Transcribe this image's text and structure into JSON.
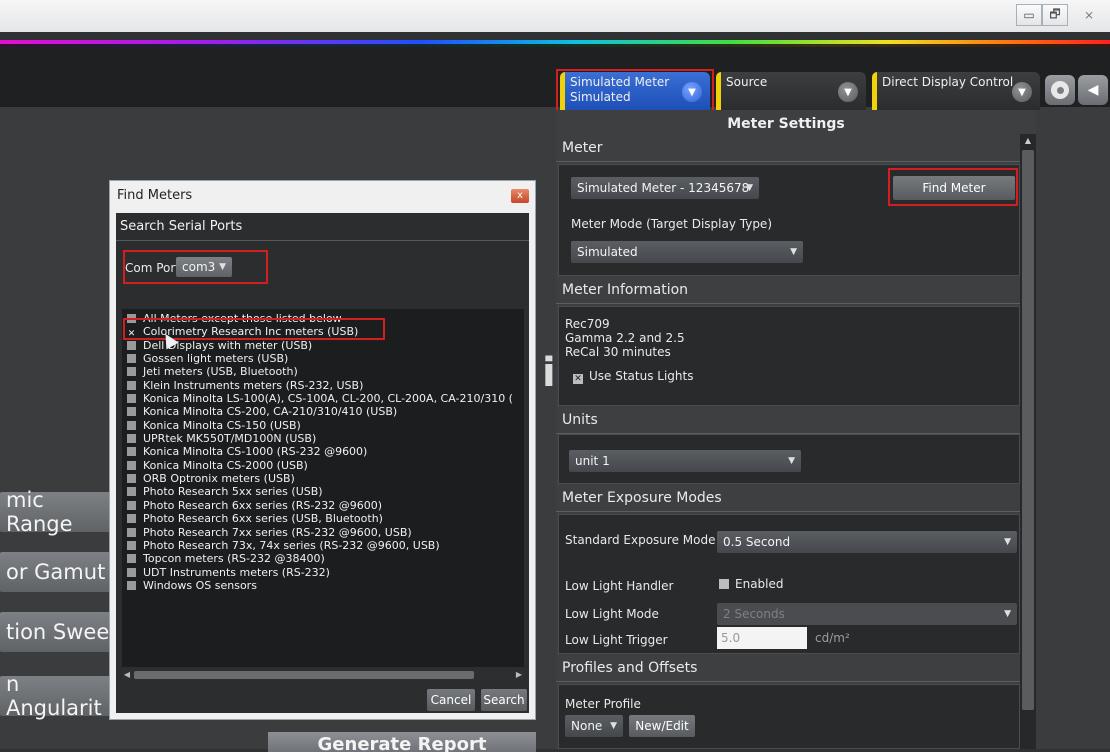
{
  "window": {
    "controls": [
      "▭",
      "🗗",
      "⨯"
    ]
  },
  "tabs": [
    {
      "line1": "Simulated Meter",
      "line2": "Simulated"
    },
    {
      "line1": "Source",
      "line2": ""
    },
    {
      "line1": "Direct Display Control",
      "line2": ""
    }
  ],
  "background": {
    "buttons": [
      "mic Range",
      "or Gamut",
      "tion Swee",
      "n Angularit"
    ],
    "big_letter": "i",
    "generate_report": "Generate Report"
  },
  "panel": {
    "title": "Meter Settings",
    "meter": {
      "header": "Meter",
      "selected_meter": "Simulated Meter - 12345678",
      "find_meter_label": "Find Meter",
      "mode_label": "Meter Mode (Target Display Type)",
      "mode_value": "Simulated"
    },
    "info": {
      "header": "Meter Information",
      "lines": [
        "Rec709",
        "Gamma 2.2 and 2.5",
        "ReCal 30 minutes"
      ],
      "status_lights_label": "Use Status Lights",
      "status_lights_checked": true
    },
    "units": {
      "header": "Units",
      "value": "unit 1"
    },
    "exposure": {
      "header": "Meter Exposure Modes",
      "standard_label": "Standard Exposure Mode",
      "standard_value": "0.5 Second",
      "low_light_handler_label": "Low Light Handler",
      "enabled_label": "Enabled",
      "low_light_mode_label": "Low Light Mode",
      "low_light_mode_value": "2 Seconds",
      "low_light_trigger_label": "Low Light Trigger",
      "low_light_trigger_value": "5.0",
      "trigger_unit": "cd/m²"
    },
    "profiles": {
      "header": "Profiles and Offsets",
      "meter_profile_label": "Meter Profile",
      "profile_value": "None",
      "new_edit_label": "New/Edit"
    }
  },
  "dialog": {
    "title": "Find Meters",
    "close_label": "x",
    "section_header": "Search Serial Ports",
    "com_port_label": "Com Port",
    "com_port_value": "com3",
    "meters": [
      {
        "label": "All Meters except those listed below",
        "checked": false
      },
      {
        "label": "Colorimetry Research Inc meters (USB)",
        "checked": true
      },
      {
        "label": "Dell Displays with meter (USB)",
        "checked": false
      },
      {
        "label": "Gossen light meters (USB)",
        "checked": false
      },
      {
        "label": "Jeti meters (USB, Bluetooth)",
        "checked": false
      },
      {
        "label": "Klein Instruments meters (RS-232, USB)",
        "checked": false
      },
      {
        "label": "Konica Minolta LS-100(A), CS-100A, CL-200, CL-200A, CA-210/310 (",
        "checked": false
      },
      {
        "label": "Konica Minolta CS-200, CA-210/310/410 (USB)",
        "checked": false
      },
      {
        "label": "Konica Minolta CS-150 (USB)",
        "checked": false
      },
      {
        "label": "UPRtek MK550T/MD100N (USB)",
        "checked": false
      },
      {
        "label": "Konica Minolta CS-1000 (RS-232 @9600)",
        "checked": false
      },
      {
        "label": "Konica Minolta CS-2000 (USB)",
        "checked": false
      },
      {
        "label": "ORB Optronix meters (USB)",
        "checked": false
      },
      {
        "label": "Photo Research 5xx series (USB)",
        "checked": false
      },
      {
        "label": "Photo Research 6xx series (RS-232 @9600)",
        "checked": false
      },
      {
        "label": "Photo Research 6xx series (USB, Bluetooth)",
        "checked": false
      },
      {
        "label": "Photo Research 7xx series (RS-232 @9600, USB)",
        "checked": false
      },
      {
        "label": "Photo Research 73x, 74x series (RS-232 @9600, USB)",
        "checked": false
      },
      {
        "label": "Topcon meters (RS-232 @38400)",
        "checked": false
      },
      {
        "label": "UDT Instruments meters (RS-232)",
        "checked": false
      },
      {
        "label": "Windows OS sensors",
        "checked": false
      }
    ],
    "cancel_label": "Cancel",
    "search_label": "Search"
  }
}
